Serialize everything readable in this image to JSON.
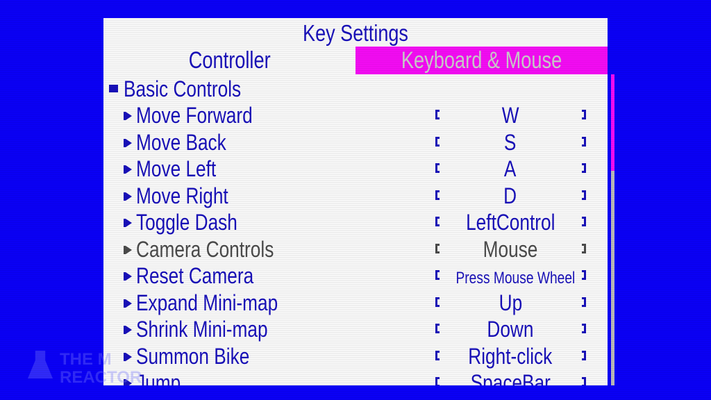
{
  "screen": {
    "title": "Key Settings",
    "tabs": [
      {
        "label": "Controller",
        "active": false
      },
      {
        "label": "Keyboard & Mouse",
        "active": true
      }
    ],
    "section": {
      "label": "Basic Controls"
    },
    "bindings": [
      {
        "action": "Move Forward",
        "key": "W",
        "enabled": true
      },
      {
        "action": "Move Back",
        "key": "S",
        "enabled": true
      },
      {
        "action": "Move Left",
        "key": "A",
        "enabled": true
      },
      {
        "action": "Move Right",
        "key": "D",
        "enabled": true
      },
      {
        "action": "Toggle Dash",
        "key": "LeftControl",
        "enabled": true
      },
      {
        "action": "Camera Controls",
        "key": "Mouse",
        "enabled": false
      },
      {
        "action": "Reset Camera",
        "key": "Press Mouse Wheel",
        "enabled": true
      },
      {
        "action": "Expand Mini-map",
        "key": "Up",
        "enabled": true
      },
      {
        "action": "Shrink Mini-map",
        "key": "Down",
        "enabled": true
      },
      {
        "action": "Summon Bike",
        "key": "Right-click",
        "enabled": true
      },
      {
        "action": "Jump",
        "key": "SpaceBar",
        "enabled": true
      }
    ],
    "scroll": {
      "thumb_fraction": 0.31,
      "position_fraction": 0.0
    }
  },
  "watermark": {
    "line1": "THE M",
    "line2": "REACTOR"
  },
  "colors": {
    "background": "#0a00f5",
    "text": "#1810b8",
    "accent": "#f20cf2",
    "disabled": "#4a4a4a",
    "tab_inactive_text": "#c9c9c9"
  }
}
